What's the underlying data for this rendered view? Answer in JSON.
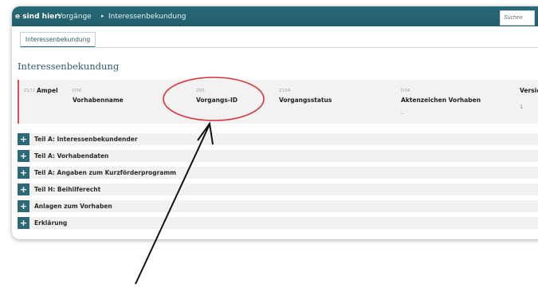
{
  "breadcrumb": {
    "label": "e sind hier:",
    "items": [
      "Vorgänge",
      "Interessenbekundung"
    ],
    "separator": "▸"
  },
  "search": {
    "placeholder": "Suchen"
  },
  "tab": {
    "label": "Interessenbekundung"
  },
  "page_title": "Interessenbekundung",
  "info": {
    "company": {
      "code": "Z172",
      "name": "Ampel"
    },
    "fields": [
      {
        "code": "D36",
        "label": "Vorhabenname",
        "value": ""
      },
      {
        "code": "Z93",
        "label": "Vorgangs-ID",
        "value": ""
      },
      {
        "code": "Z104",
        "label": "Vorgangsstatus",
        "value": ""
      },
      {
        "code": "D34",
        "label": "Aktenzeichen Vorhaben",
        "value": "–"
      },
      {
        "code": "",
        "label": "Version",
        "value": "1"
      }
    ]
  },
  "sections": [
    "Teil A: Interessenbekundender",
    "Teil A: Vorhabendaten",
    "Teil A: Angaben zum Kurzförderprogramm",
    "Teil H: Beihilferecht",
    "Anlagen zum Vorhaben",
    "Erklärung"
  ],
  "colors": {
    "topbar": "#215d6b",
    "accent": "#2c6a79",
    "annotation_circle": "#d9363e",
    "annotation_arrow": "#111111"
  },
  "icons": {
    "section_toggle": "plus-icon",
    "breadcrumb_separator": "triangle-right-icon"
  }
}
